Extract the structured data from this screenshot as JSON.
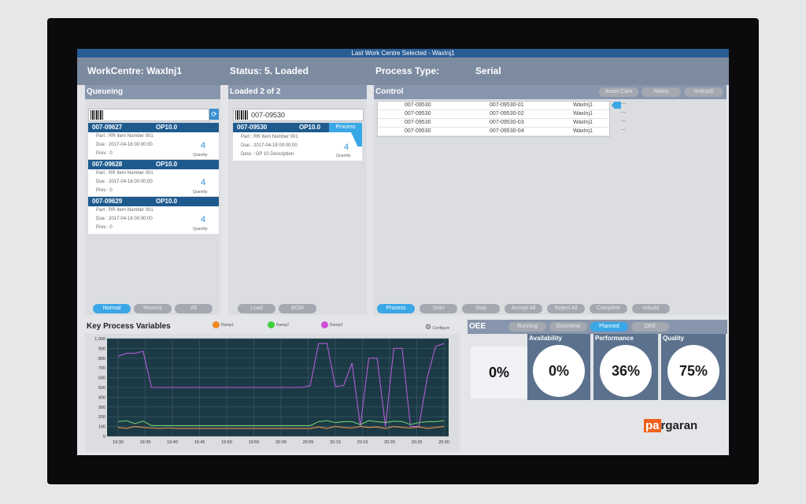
{
  "title": "Last Work Centre Selected - WaxInj1",
  "header": {
    "workcentre": "WorkCentre: WaxInj1",
    "status": "Status: 5. Loaded",
    "process_type_label": "Process Type:",
    "process_type": "Serial"
  },
  "queue": {
    "title": "Queueing",
    "cards": [
      {
        "id": "007-09627",
        "op": "OP10.0",
        "part": "Part :  RR Item Number 001",
        "due": "Due :  2017-04-18 00:00:00",
        "prev": "Prev :  0",
        "qty": "4",
        "qty_label": "Quantity"
      },
      {
        "id": "007-09628",
        "op": "OP10.0",
        "part": "Part :  RR Item Number 001",
        "due": "Due :  2017-04-18 00:00:00",
        "prev": "Prev :  0",
        "qty": "4",
        "qty_label": "Quantity"
      },
      {
        "id": "007-09629",
        "op": "OP10.0",
        "part": "Part :  RR Item Number 001",
        "due": "Due :  2017-04-18 00:00:00",
        "prev": "Prev :  0",
        "qty": "4",
        "qty_label": "Quantity"
      }
    ],
    "buttons": [
      "Normal",
      "Rework",
      "All"
    ]
  },
  "loaded": {
    "title": "Loaded   2  of  2",
    "scan_value": "007-09530",
    "card": {
      "id": "007-09530",
      "op": "OP10.0",
      "tag": "Process",
      "part": "Part :  RR Item Number 001",
      "due": "Due :  2017-04-18 00:00:00",
      "desc": "Desc :  OP 10 Description",
      "qty": "4",
      "qty_label": "Quantity"
    },
    "buttons": [
      "Load",
      "BOM"
    ]
  },
  "control": {
    "title": "Control",
    "top_buttons": [
      "Asset Care",
      "Notes",
      "Instructi"
    ],
    "rows": [
      {
        "a": "007-09530",
        "b": "007-09530-01",
        "c": "WaxInj1",
        "d": "..."
      },
      {
        "a": "007-09530",
        "b": "007-09530-02",
        "c": "WaxInj1",
        "d": "..."
      },
      {
        "a": "007-09530",
        "b": "007-09530-03",
        "c": "WaxInj1",
        "d": "..."
      },
      {
        "a": "007-09530",
        "b": "007-09530-04",
        "c": "WaxInj1",
        "d": "..."
      }
    ],
    "buttons": [
      "Process",
      "Start",
      "Stop",
      "Accept All",
      "Reject All",
      "Complete",
      "Inbuild"
    ]
  },
  "kpv": {
    "title": "Key Process Variables",
    "configure": "Configure",
    "legend": [
      {
        "name": "Ramp1",
        "color": "#f08a24"
      },
      {
        "name": "Ramp2",
        "color": "#3ecf3e"
      },
      {
        "name": "Ramp3",
        "color": "#d04fd8"
      }
    ]
  },
  "chart_data": {
    "type": "line",
    "title": "",
    "xlabel": "",
    "ylabel": "",
    "ylim": [
      0,
      1000
    ],
    "yticks": [
      "1,000",
      "900",
      "800",
      "700",
      "600",
      "500",
      "400",
      "300",
      "200",
      "100",
      "0"
    ],
    "xticks": [
      "19:30",
      "19:35",
      "19:40",
      "19:45",
      "19:50",
      "19:55",
      "20:00",
      "20:05",
      "20:10",
      "20:15",
      "20:20",
      "20:25",
      "20:30"
    ],
    "grid": true,
    "series": [
      {
        "name": "Ramp3",
        "color": "#b35bd6",
        "values": [
          820,
          850,
          850,
          870,
          500,
          500,
          500,
          500,
          500,
          500,
          500,
          500,
          500,
          500,
          500,
          500,
          500,
          500,
          500,
          500,
          500,
          500,
          500,
          520,
          950,
          950,
          510,
          520,
          750,
          100,
          800,
          800,
          100,
          900,
          900,
          100,
          100,
          600,
          920,
          950
        ]
      },
      {
        "name": "Ramp1",
        "color": "#e8954a",
        "values": [
          90,
          80,
          100,
          90,
          85,
          80,
          85,
          80,
          80,
          80,
          80,
          80,
          80,
          80,
          80,
          80,
          80,
          80,
          80,
          80,
          80,
          80,
          80,
          80,
          95,
          80,
          100,
          90,
          85,
          100,
          90,
          95,
          80,
          100,
          90,
          85,
          95,
          80,
          90,
          100
        ]
      },
      {
        "name": "Ramp2",
        "color": "#6fc86f",
        "values": [
          150,
          160,
          130,
          155,
          110,
          110,
          110,
          110,
          110,
          110,
          110,
          110,
          110,
          110,
          110,
          110,
          110,
          110,
          110,
          110,
          110,
          110,
          110,
          110,
          150,
          160,
          140,
          150,
          150,
          120,
          160,
          150,
          140,
          155,
          150,
          120,
          140,
          150,
          150,
          160
        ]
      }
    ]
  },
  "oee": {
    "title": "OEE",
    "tabs": [
      "Running",
      "Downtime",
      "Planned",
      "OEE"
    ],
    "overall": "0%",
    "availability": {
      "label": "Availability",
      "value": "0%"
    },
    "performance": {
      "label": "Performance",
      "value": "36%"
    },
    "quality": {
      "label": "Quality",
      "value": "75%"
    }
  },
  "watermark": {
    "a": "pa",
    "b": "rgaran"
  }
}
